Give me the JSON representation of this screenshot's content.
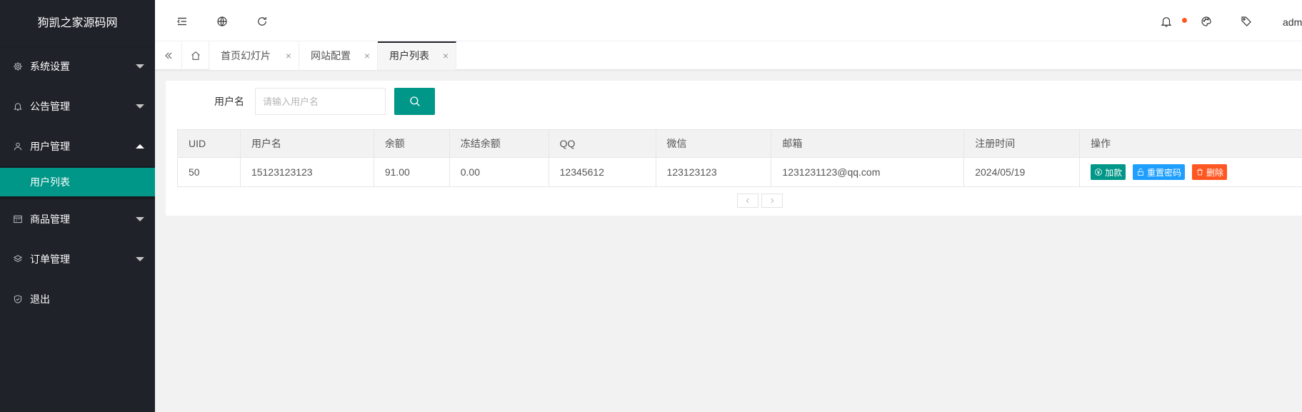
{
  "sidebar": {
    "logo": "狗凯之家源码网",
    "items": [
      {
        "label": "系统设置",
        "icon": "gear-icon"
      },
      {
        "label": "公告管理",
        "icon": "bell-icon"
      },
      {
        "label": "用户管理",
        "icon": "user-icon"
      },
      {
        "label": "商品管理",
        "icon": "shop-icon"
      },
      {
        "label": "订单管理",
        "icon": "layers-icon"
      },
      {
        "label": "退出",
        "icon": "shield-icon"
      }
    ],
    "sub_item": "用户列表"
  },
  "header": {
    "username": "adm"
  },
  "tabs": [
    {
      "label": "首页幻灯片",
      "close": "×"
    },
    {
      "label": "网站配置",
      "close": "×"
    },
    {
      "label": "用户列表",
      "close": "×"
    }
  ],
  "search": {
    "label": "用户名",
    "placeholder": "请输入用户名"
  },
  "table": {
    "headers": [
      "UID",
      "用户名",
      "余额",
      "冻结余额",
      "QQ",
      "微信",
      "邮箱",
      "注册时间",
      "操作"
    ],
    "rows": [
      {
        "uid": "50",
        "username": "15123123123",
        "balance": "91.00",
        "frozen": "0.00",
        "qq": "12345612",
        "wechat": "123123123",
        "email": "1231231123@qq.com",
        "registered": "2024/05/19"
      }
    ],
    "actions": {
      "add": "加款",
      "reset": "重置密码",
      "delete": "删除"
    }
  },
  "colors": {
    "sidebar_bg": "#20222a",
    "accent": "#009688",
    "blue": "#1e9fff",
    "orange": "#ff5722"
  }
}
